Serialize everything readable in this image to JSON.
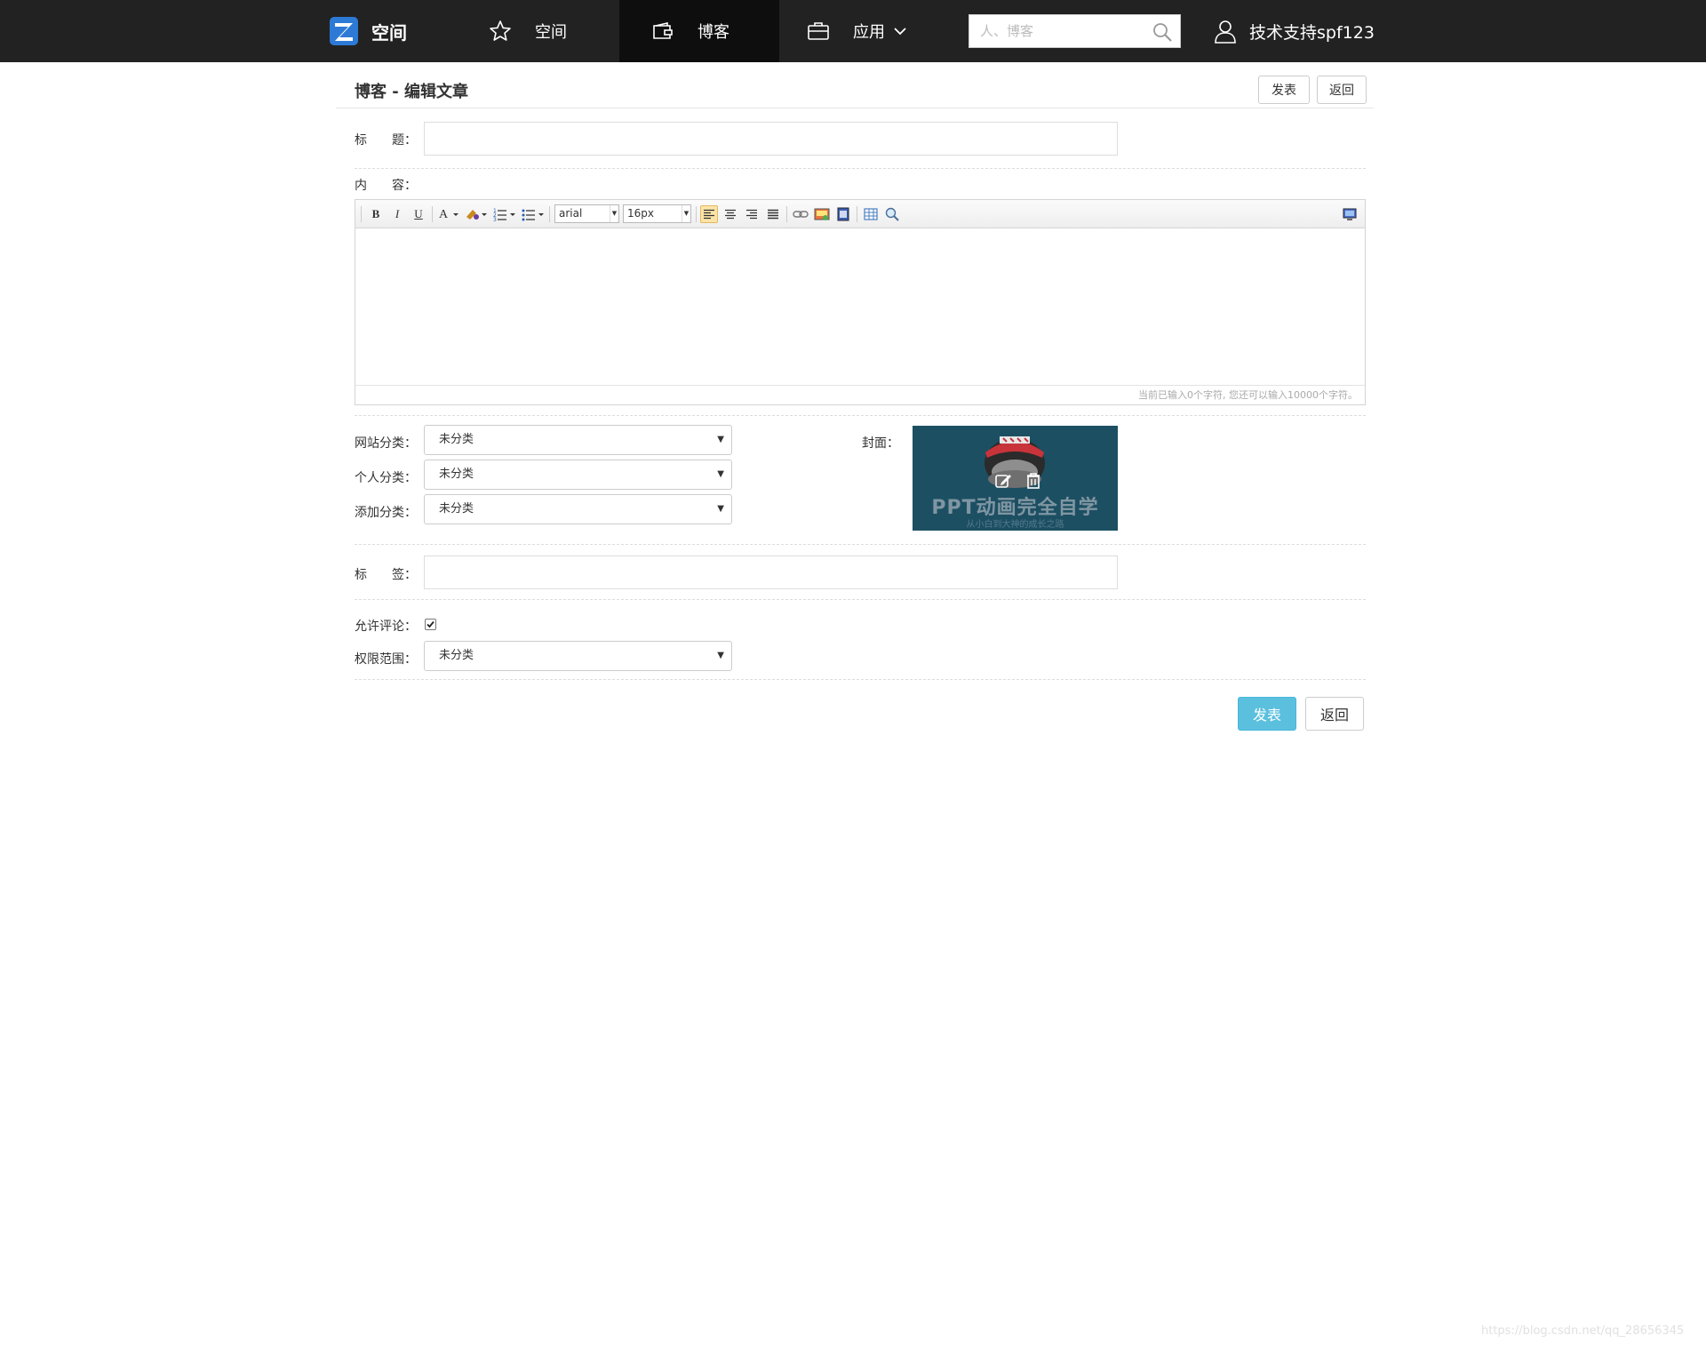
{
  "nav": {
    "brand_label": "空间",
    "items": [
      {
        "label": "空间",
        "icon": "star-icon"
      },
      {
        "label": "博客",
        "icon": "wallet-icon",
        "active": true
      },
      {
        "label": "应用",
        "icon": "briefcase-icon",
        "dropdown": true
      }
    ],
    "search_placeholder": "人、博客",
    "user_name": "技术支持spf123"
  },
  "header": {
    "title": "博客 - 编辑文章",
    "publish_label": "发表",
    "back_label": "返回"
  },
  "form": {
    "title_label": "标　　题：",
    "content_label": "内　　容：",
    "font_family": "arial",
    "font_size": "16px",
    "char_count_text": "当前已输入0个字符, 您还可以输入10000个字符。",
    "site_category_label": "网站分类：",
    "site_category_value": "未分类",
    "personal_category_label": "个人分类：",
    "personal_category_value": "未分类",
    "add_category_label": "添加分类：",
    "add_category_value": "未分类",
    "cover_label": "封面：",
    "cover_text": "PPT动画完全自学",
    "cover_subtext": "从小白到大神的成长之路",
    "tags_label": "标　　签：",
    "allow_comment_label": "允许评论：",
    "allow_comment_checked": true,
    "permission_label": "权限范围：",
    "permission_value": "未分类"
  },
  "footer": {
    "publish_label": "发表",
    "back_label": "返回"
  },
  "watermark": "https://blog.csdn.net/qq_28656345",
  "colors": {
    "topbar": "#222222",
    "nav_active": "#0e0e0e",
    "primary_button": "#5bc0de",
    "cover_bg": "#1d4f63"
  }
}
